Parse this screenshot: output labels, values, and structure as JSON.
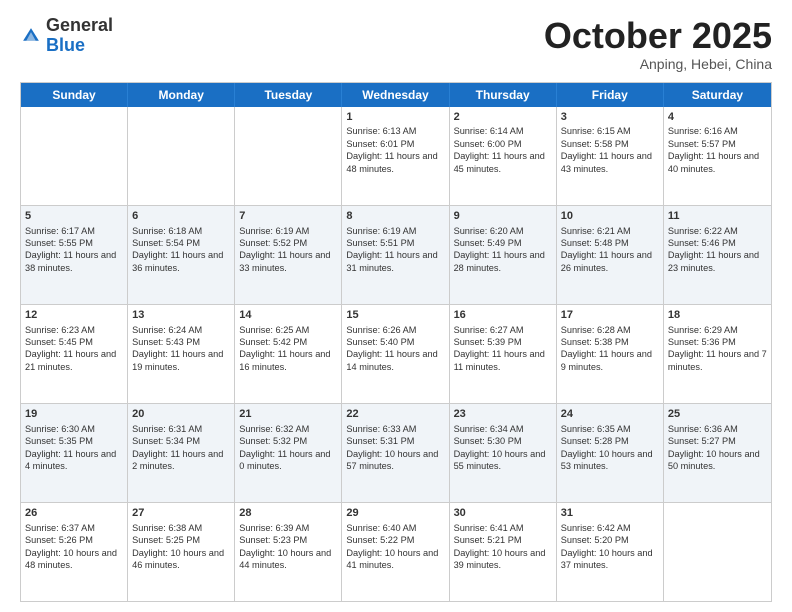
{
  "header": {
    "logo_general": "General",
    "logo_blue": "Blue",
    "month": "October 2025",
    "location": "Anping, Hebei, China"
  },
  "days_of_week": [
    "Sunday",
    "Monday",
    "Tuesday",
    "Wednesday",
    "Thursday",
    "Friday",
    "Saturday"
  ],
  "rows": [
    {
      "alt": false,
      "cells": [
        {
          "day": "",
          "text": ""
        },
        {
          "day": "",
          "text": ""
        },
        {
          "day": "",
          "text": ""
        },
        {
          "day": "1",
          "text": "Sunrise: 6:13 AM\nSunset: 6:01 PM\nDaylight: 11 hours and 48 minutes."
        },
        {
          "day": "2",
          "text": "Sunrise: 6:14 AM\nSunset: 6:00 PM\nDaylight: 11 hours and 45 minutes."
        },
        {
          "day": "3",
          "text": "Sunrise: 6:15 AM\nSunset: 5:58 PM\nDaylight: 11 hours and 43 minutes."
        },
        {
          "day": "4",
          "text": "Sunrise: 6:16 AM\nSunset: 5:57 PM\nDaylight: 11 hours and 40 minutes."
        }
      ]
    },
    {
      "alt": true,
      "cells": [
        {
          "day": "5",
          "text": "Sunrise: 6:17 AM\nSunset: 5:55 PM\nDaylight: 11 hours and 38 minutes."
        },
        {
          "day": "6",
          "text": "Sunrise: 6:18 AM\nSunset: 5:54 PM\nDaylight: 11 hours and 36 minutes."
        },
        {
          "day": "7",
          "text": "Sunrise: 6:19 AM\nSunset: 5:52 PM\nDaylight: 11 hours and 33 minutes."
        },
        {
          "day": "8",
          "text": "Sunrise: 6:19 AM\nSunset: 5:51 PM\nDaylight: 11 hours and 31 minutes."
        },
        {
          "day": "9",
          "text": "Sunrise: 6:20 AM\nSunset: 5:49 PM\nDaylight: 11 hours and 28 minutes."
        },
        {
          "day": "10",
          "text": "Sunrise: 6:21 AM\nSunset: 5:48 PM\nDaylight: 11 hours and 26 minutes."
        },
        {
          "day": "11",
          "text": "Sunrise: 6:22 AM\nSunset: 5:46 PM\nDaylight: 11 hours and 23 minutes."
        }
      ]
    },
    {
      "alt": false,
      "cells": [
        {
          "day": "12",
          "text": "Sunrise: 6:23 AM\nSunset: 5:45 PM\nDaylight: 11 hours and 21 minutes."
        },
        {
          "day": "13",
          "text": "Sunrise: 6:24 AM\nSunset: 5:43 PM\nDaylight: 11 hours and 19 minutes."
        },
        {
          "day": "14",
          "text": "Sunrise: 6:25 AM\nSunset: 5:42 PM\nDaylight: 11 hours and 16 minutes."
        },
        {
          "day": "15",
          "text": "Sunrise: 6:26 AM\nSunset: 5:40 PM\nDaylight: 11 hours and 14 minutes."
        },
        {
          "day": "16",
          "text": "Sunrise: 6:27 AM\nSunset: 5:39 PM\nDaylight: 11 hours and 11 minutes."
        },
        {
          "day": "17",
          "text": "Sunrise: 6:28 AM\nSunset: 5:38 PM\nDaylight: 11 hours and 9 minutes."
        },
        {
          "day": "18",
          "text": "Sunrise: 6:29 AM\nSunset: 5:36 PM\nDaylight: 11 hours and 7 minutes."
        }
      ]
    },
    {
      "alt": true,
      "cells": [
        {
          "day": "19",
          "text": "Sunrise: 6:30 AM\nSunset: 5:35 PM\nDaylight: 11 hours and 4 minutes."
        },
        {
          "day": "20",
          "text": "Sunrise: 6:31 AM\nSunset: 5:34 PM\nDaylight: 11 hours and 2 minutes."
        },
        {
          "day": "21",
          "text": "Sunrise: 6:32 AM\nSunset: 5:32 PM\nDaylight: 11 hours and 0 minutes."
        },
        {
          "day": "22",
          "text": "Sunrise: 6:33 AM\nSunset: 5:31 PM\nDaylight: 10 hours and 57 minutes."
        },
        {
          "day": "23",
          "text": "Sunrise: 6:34 AM\nSunset: 5:30 PM\nDaylight: 10 hours and 55 minutes."
        },
        {
          "day": "24",
          "text": "Sunrise: 6:35 AM\nSunset: 5:28 PM\nDaylight: 10 hours and 53 minutes."
        },
        {
          "day": "25",
          "text": "Sunrise: 6:36 AM\nSunset: 5:27 PM\nDaylight: 10 hours and 50 minutes."
        }
      ]
    },
    {
      "alt": false,
      "cells": [
        {
          "day": "26",
          "text": "Sunrise: 6:37 AM\nSunset: 5:26 PM\nDaylight: 10 hours and 48 minutes."
        },
        {
          "day": "27",
          "text": "Sunrise: 6:38 AM\nSunset: 5:25 PM\nDaylight: 10 hours and 46 minutes."
        },
        {
          "day": "28",
          "text": "Sunrise: 6:39 AM\nSunset: 5:23 PM\nDaylight: 10 hours and 44 minutes."
        },
        {
          "day": "29",
          "text": "Sunrise: 6:40 AM\nSunset: 5:22 PM\nDaylight: 10 hours and 41 minutes."
        },
        {
          "day": "30",
          "text": "Sunrise: 6:41 AM\nSunset: 5:21 PM\nDaylight: 10 hours and 39 minutes."
        },
        {
          "day": "31",
          "text": "Sunrise: 6:42 AM\nSunset: 5:20 PM\nDaylight: 10 hours and 37 minutes."
        },
        {
          "day": "",
          "text": ""
        }
      ]
    }
  ]
}
